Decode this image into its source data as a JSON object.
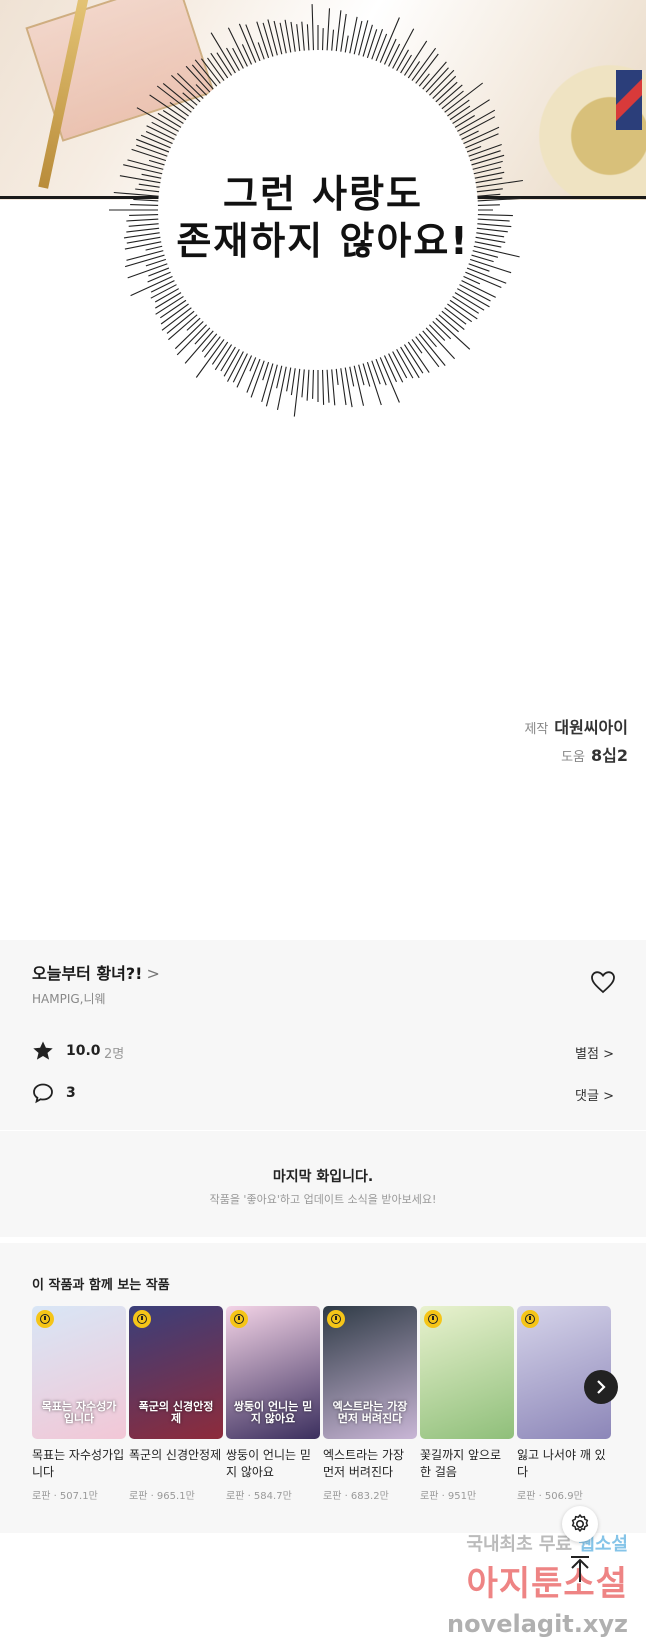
{
  "comic": {
    "speech_line1": "그런 사랑도",
    "speech_line2": "존재하지 않아요!"
  },
  "credits": [
    {
      "role": "제작",
      "name": "대원씨아이"
    },
    {
      "role": "도움",
      "name": "8십2"
    }
  ],
  "series": {
    "title": "오늘부터 황녀?!",
    "title_chevron": ">",
    "authors": "HAMPIG,니웨",
    "rating": "10.0",
    "rating_count": "2명",
    "rate_link": "별점 >",
    "comments": "3",
    "comment_link": "댓글 >"
  },
  "last_episode": {
    "title": "마지막 화입니다.",
    "subtitle": "작품을 '좋아요'하고 업데이트 소식을 받아보세요!"
  },
  "recommendations": {
    "heading": "이 작품과 함께 보는 작품",
    "items": [
      {
        "name": "목표는 자수성가입니다",
        "meta": "로판 · 507.1만",
        "cover_text": "목표는 자수성가입니다",
        "colors": [
          "#d8e6f6",
          "#f2c7d6"
        ]
      },
      {
        "name": "폭군의 신경안정제",
        "meta": "로판 · 965.1만",
        "cover_text": "폭군의 신경안정제",
        "colors": [
          "#3a3f7a",
          "#8e2b3b"
        ]
      },
      {
        "name": "쌍둥이 언니는 믿지 않아요",
        "meta": "로판 · 584.7만",
        "cover_text": "쌍둥이 언니는 믿지 않아요",
        "colors": [
          "#f3d3e6",
          "#3b2f5e"
        ]
      },
      {
        "name": "엑스트라는 가장 먼저 버려진다",
        "meta": "로판 · 683.2만",
        "cover_text": "엑스트라는 가장 먼저 버려진다",
        "colors": [
          "#2f3b46",
          "#c9b6d6"
        ]
      },
      {
        "name": "꽃길까지 앞으로 한 걸음",
        "meta": "로판 · 951만",
        "cover_text": "",
        "colors": [
          "#e9f2cf",
          "#8fbf7a"
        ]
      },
      {
        "name": "잃고 나서야 깨 있다",
        "meta": "로판 · 506.9만",
        "cover_text": "",
        "colors": [
          "#d6d4ea",
          "#8c86b8"
        ]
      }
    ]
  },
  "watermark": {
    "line1_a": "국내최초 무료 ",
    "line1_b": "웹소설",
    "line2": "아지툰소설",
    "line3": "novelagit.xyz"
  }
}
